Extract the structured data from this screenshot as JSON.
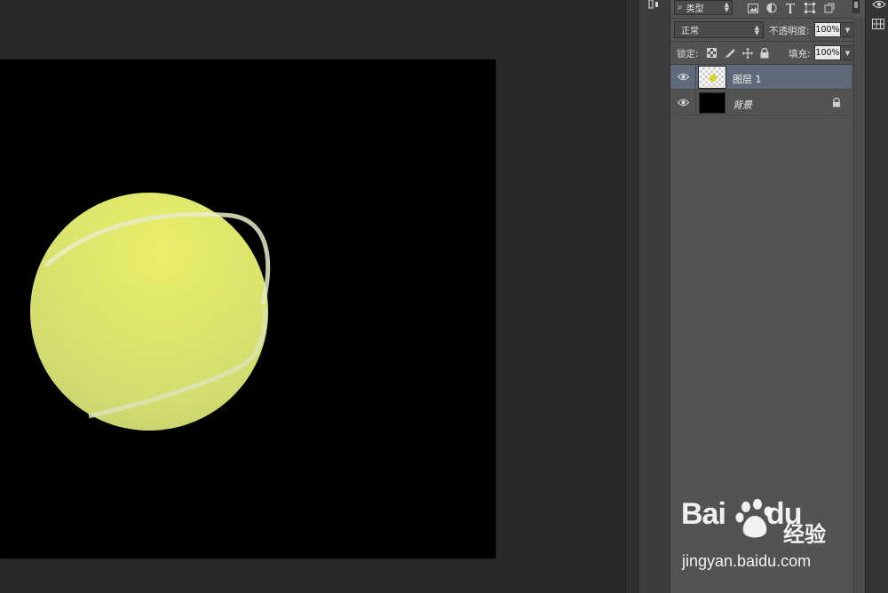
{
  "layers_panel": {
    "filter": {
      "selected": "类型",
      "search_glyph": "⌕"
    },
    "filter_icons": [
      "image-icon",
      "adjustment-icon",
      "type-icon",
      "shape-icon",
      "smart-object-icon"
    ],
    "blend_mode": "正常",
    "opacity_label": "不透明度:",
    "opacity_value": "100%",
    "lock_label": "锁定:",
    "fill_label": "填充:",
    "fill_value": "100%",
    "layers": [
      {
        "name": "图层 1",
        "visible": true,
        "selected": true,
        "thumbnail": "transparent-with-ball"
      },
      {
        "name": "背景",
        "visible": true,
        "selected": false,
        "locked": true,
        "thumbnail": "black"
      }
    ]
  },
  "canvas": {
    "background_color": "#000000",
    "subject": "tennis-ball",
    "ball_color": "#d4e021"
  },
  "watermark": {
    "logo_text": "Bai",
    "logo_text_b": "du",
    "brand_cn": "经验",
    "url": "jingyan.baidu.com"
  },
  "colors": {
    "workspace": "#282828",
    "panel": "#535353",
    "selected_layer": "#5e6a7a"
  }
}
